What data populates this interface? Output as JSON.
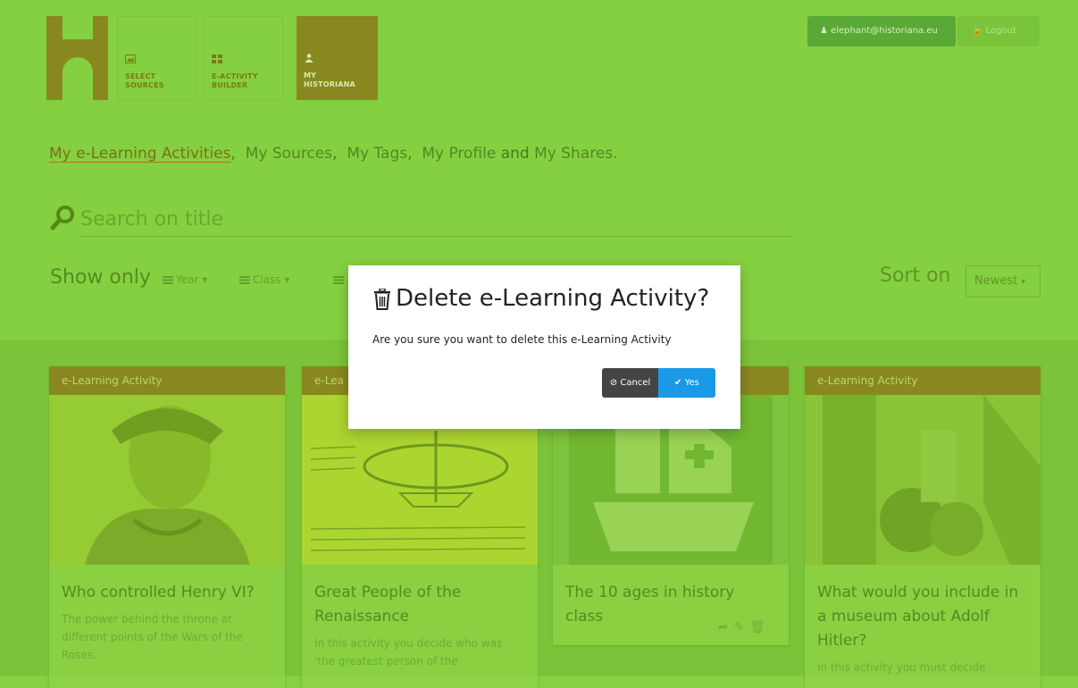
{
  "nav": {
    "tiles": [
      {
        "line1": "SELECT",
        "line2": "SOURCES"
      },
      {
        "line1": "E-ACTIVITY",
        "line2": "BUILDER"
      },
      {
        "line1": "MY",
        "line2": "HISTORIANA"
      }
    ],
    "user_email": "elephant@historiana.eu",
    "logout_label": "Logout"
  },
  "links": {
    "items": [
      "My e-Learning Activities",
      "My Sources",
      "My Tags",
      "My Profile",
      "My Shares."
    ],
    "sep1": ",",
    "sep2": ",",
    "sep3": ",",
    "and_word": "and"
  },
  "search": {
    "placeholder": "Search on title"
  },
  "filters": {
    "show_only_label": "Show only",
    "items": [
      "Year",
      "Class"
    ]
  },
  "sort": {
    "label": "Sort on",
    "value": "Newest"
  },
  "cards": [
    {
      "type": "e-Learning Activity",
      "title": "Who controlled Henry VI?",
      "desc": "The power behind the throne at different points of the Wars of the Roses."
    },
    {
      "type": "e-Lea",
      "title": "Great People of the Renaissance",
      "desc": "In this activity you decide who was 'the greatest person of the"
    },
    {
      "type": "",
      "title": "The 10 ages in history class",
      "desc": ""
    },
    {
      "type": "e-Learning Activity",
      "title": "What would you include in a museum about Adolf Hitler?",
      "desc": "In this activity you must decide"
    }
  ],
  "modal": {
    "title": "Delete e-Learning Activity?",
    "text": "Are you sure you want to delete this e-Learning Activity",
    "cancel_label": "Cancel",
    "yes_label": "Yes"
  },
  "colors": {
    "accent_green": "#88d246",
    "brand_brown": "#8d7a1f",
    "yes_blue": "#1a99e6",
    "cancel_dark": "#444444"
  }
}
